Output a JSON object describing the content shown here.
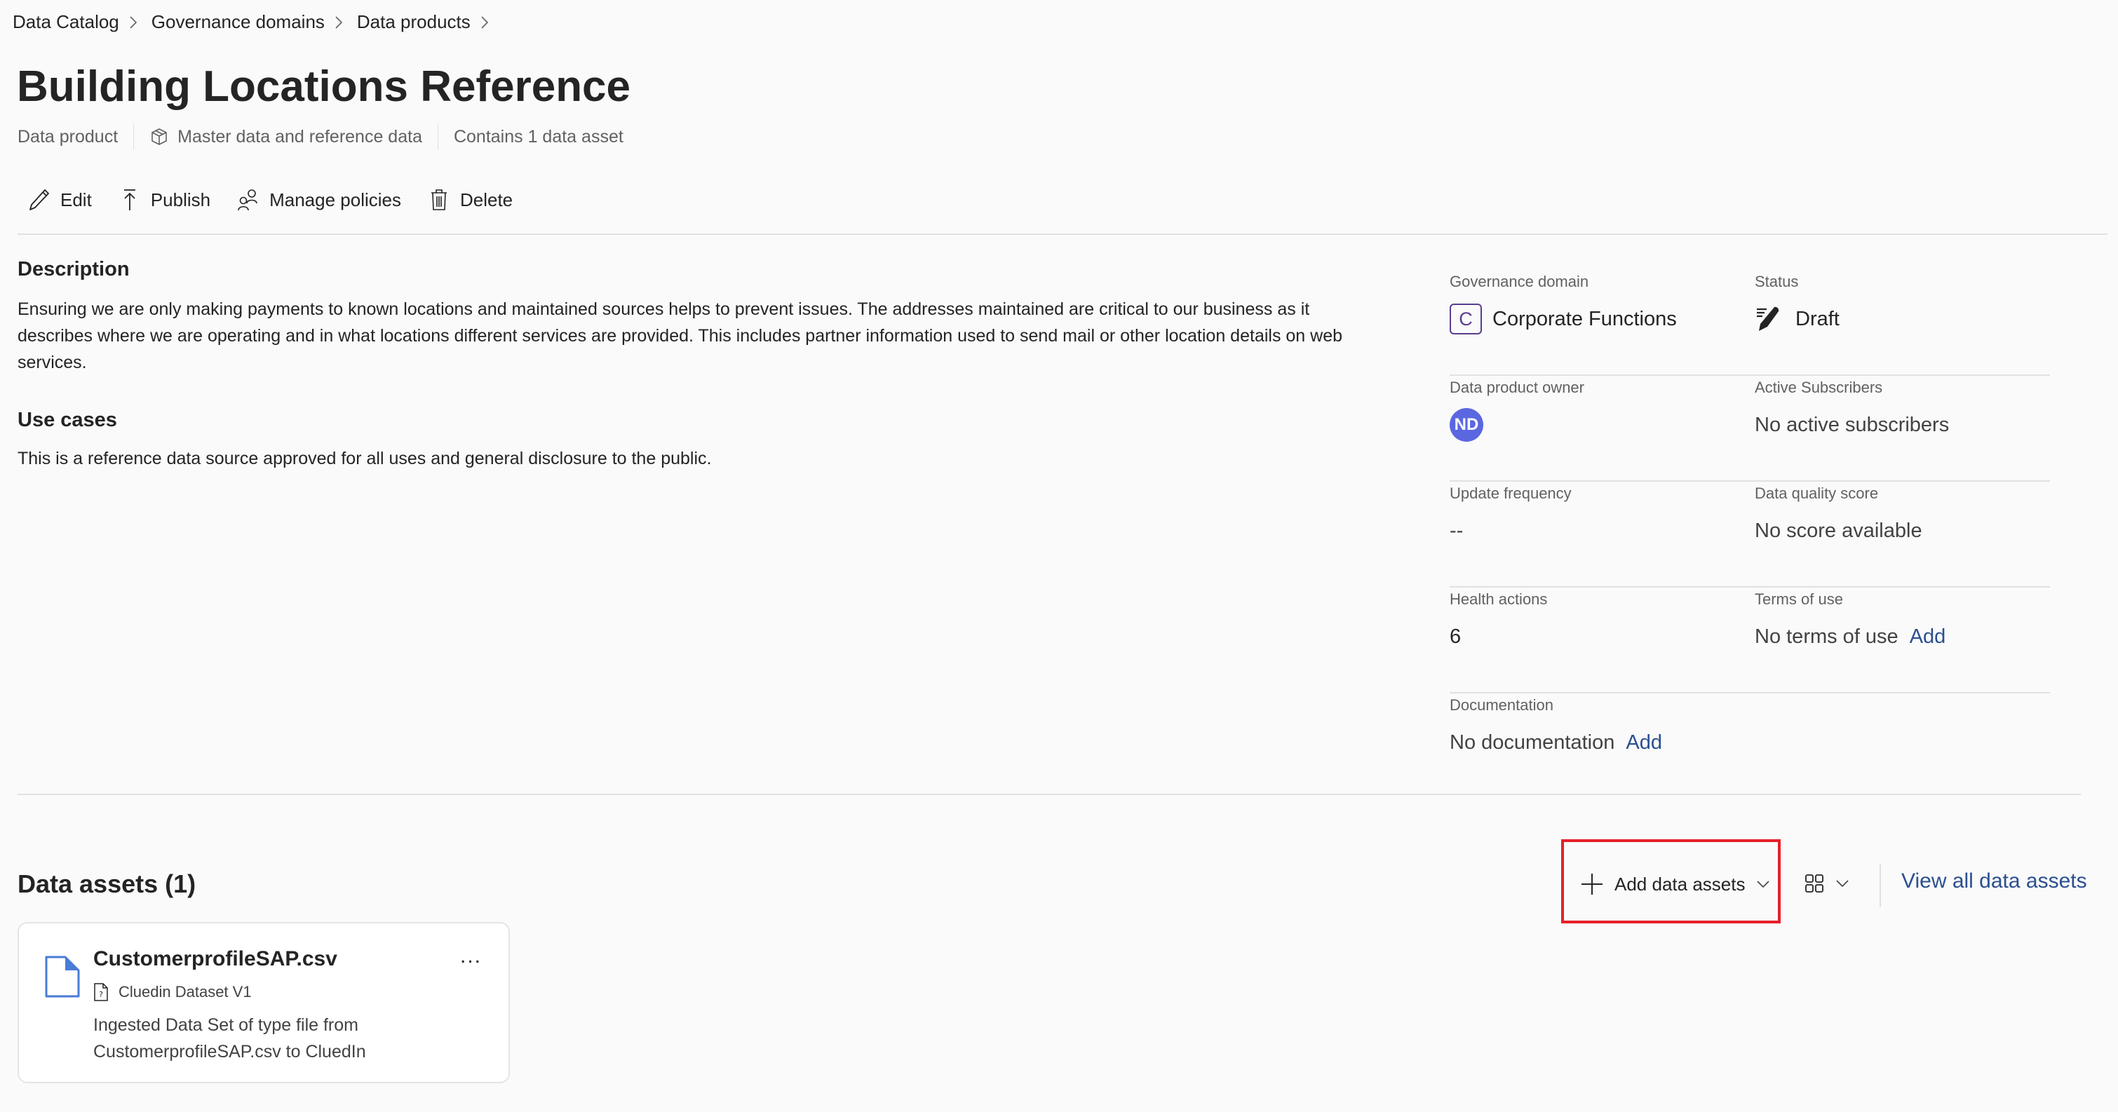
{
  "breadcrumb": [
    "Data Catalog",
    "Governance domains",
    "Data products"
  ],
  "title": "Building Locations Reference",
  "meta": {
    "type": "Data product",
    "category_icon": "cube-icon",
    "category": "Master data and reference data",
    "asset_count": "Contains 1 data asset"
  },
  "toolbar": {
    "edit": "Edit",
    "publish": "Publish",
    "manage_policies": "Manage policies",
    "delete": "Delete"
  },
  "description": {
    "heading": "Description",
    "text": "Ensuring we are only making payments to known locations and maintained sources helps to prevent issues.  The addresses maintained are critical to our business as it describes where we are operating and in what locations different services are provided.  This includes partner information used to send mail or other location details on web services."
  },
  "use_cases": {
    "heading": "Use cases",
    "text": "This is a reference data source approved for all uses and general disclosure to the public."
  },
  "properties": {
    "governance_domain": {
      "label": "Governance domain",
      "badge": "C",
      "value": "Corporate Functions",
      "badge_color": "#5b3d8f"
    },
    "status": {
      "label": "Status",
      "value": "Draft",
      "icon": "draft-pen-icon"
    },
    "owner": {
      "label": "Data product owner",
      "initials": "ND",
      "avatar_color": "#5b67e1"
    },
    "active_subscribers": {
      "label": "Active Subscribers",
      "value": "No active subscribers"
    },
    "update_frequency": {
      "label": "Update frequency",
      "value": "--"
    },
    "data_quality": {
      "label": "Data quality score",
      "value": "No score available"
    },
    "health_actions": {
      "label": "Health actions",
      "value": "6"
    },
    "terms_of_use": {
      "label": "Terms of use",
      "value": "No terms of use",
      "action": "Add"
    },
    "documentation": {
      "label": "Documentation",
      "value": "No documentation",
      "action": "Add"
    }
  },
  "data_assets": {
    "heading": "Data assets (1)",
    "add_button": "Add data assets",
    "view_toggle_icon": "grid-view-icon",
    "view_all": "View all data assets",
    "items": [
      {
        "name": "CustomerprofileSAP.csv",
        "type": "Cluedin Dataset V1",
        "description": "Ingested Data Set of type file from CustomerprofileSAP.csv to CluedIn",
        "more": "..."
      }
    ]
  },
  "colors": {
    "link": "#2b4f8f",
    "highlight_box": "#e5202a",
    "file_icon": "#4a7bd6"
  }
}
